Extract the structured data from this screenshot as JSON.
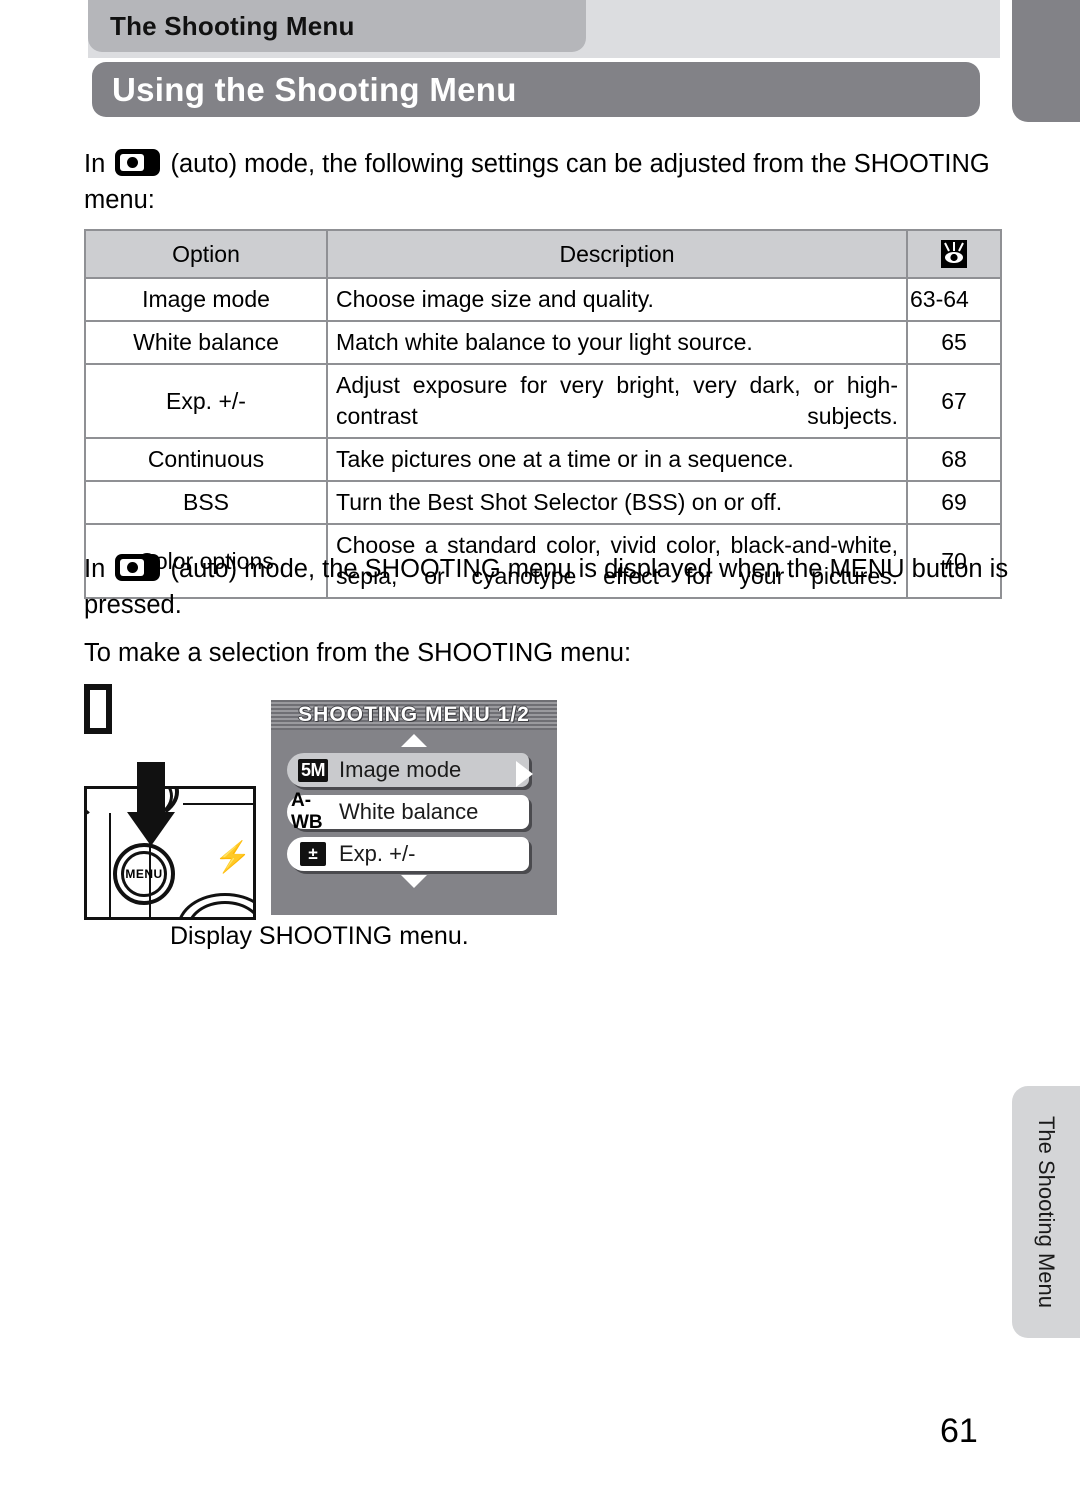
{
  "running_head": {
    "label": "The Shooting Menu"
  },
  "title": {
    "label": "Using the Shooting Menu"
  },
  "thumb_index": {
    "label": "The Shooting Menu"
  },
  "paragraphs": {
    "intro_before_icon": "In",
    "intro_after_icon": "(auto) mode, the following settings can be adjusted from the SHOOTING menu:",
    "menu_before_icon": "In",
    "menu_after_icon": "(auto) mode, the SHOOTING menu is displayed when the MENU button is pressed.",
    "selection": "To make a selection from the SHOOTING menu:"
  },
  "table": {
    "headers": {
      "option": "Option",
      "description": "Description",
      "reference": "reference-eye-icon"
    },
    "rows": [
      {
        "option": "Image mode",
        "description": "Choose image size and quality.",
        "ref": "63-64",
        "justify": false
      },
      {
        "option": "White balance",
        "description": "Match white balance to your light source.",
        "ref": "65",
        "justify": false
      },
      {
        "option": "Exp. +/-",
        "description": "Adjust exposure for very bright, very dark, or high-contrast subjects.",
        "ref": "67",
        "justify": true
      },
      {
        "option": "Continuous",
        "description": "Take pictures one at a time or in a sequence.",
        "ref": "68",
        "justify": false
      },
      {
        "option": "BSS",
        "description": "Turn the Best Shot Selector (BSS) on or off.",
        "ref": "69",
        "justify": false
      },
      {
        "option": "Color options",
        "description": "Choose a standard color, vivid color, black-and-white, sepia, or cyanotype effect for your pictures.",
        "ref": "70",
        "justify": true
      }
    ]
  },
  "step": {
    "number": "",
    "caption": "Display SHOOTING menu.",
    "camera": {
      "menu_button_label": "MENU"
    }
  },
  "lcd": {
    "title": "SHOOTING MENU 1/2",
    "items": [
      {
        "badge": "5M",
        "label": "Image mode",
        "selected": true
      },
      {
        "badge": "A-WB",
        "label": "White balance",
        "selected": false
      },
      {
        "badge": "EV",
        "label": "Exp. +/-",
        "selected": false
      }
    ]
  },
  "folio": {
    "page_number": "61"
  },
  "colors": {
    "title_bar": "#828287",
    "runhead_tab": "#b5b6ba",
    "runhead_band": "#dcdde0",
    "thumb_tab_side": "#d4d5d7",
    "table_header": "#cdced1",
    "table_border": "#8f9094",
    "lcd_bg": "#838388"
  }
}
